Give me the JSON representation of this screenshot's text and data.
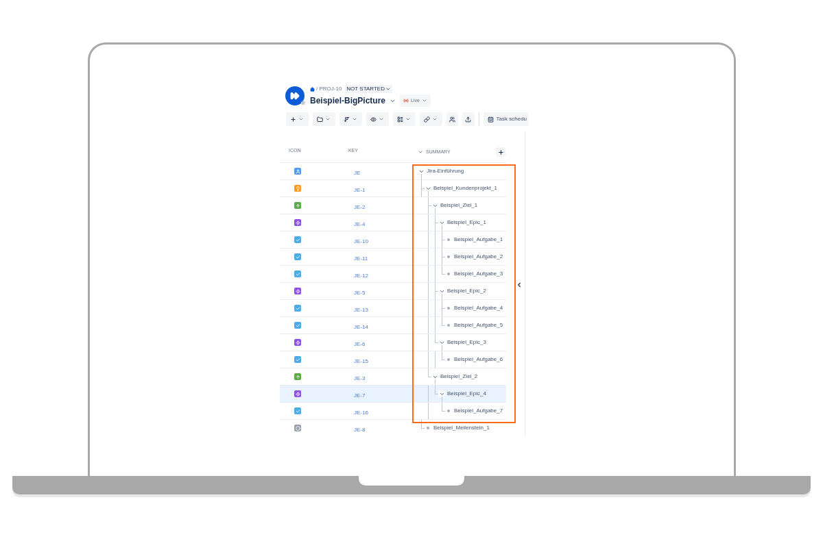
{
  "breadcrumb": {
    "project": "/ PROJ-10",
    "status": "NOT STARTED"
  },
  "title": "Beispiel-BigPicture",
  "mode_button": "Live",
  "toolbar": [
    {
      "kind": "plus"
    },
    {
      "kind": "folder"
    },
    {
      "kind": "sort"
    },
    {
      "kind": "eye"
    },
    {
      "kind": "layout"
    },
    {
      "kind": "link"
    },
    {
      "kind": "people"
    },
    {
      "kind": "upload"
    }
  ],
  "task_button": "Task schedu",
  "columns": [
    "ICON",
    "KEY",
    "SUMMARY"
  ],
  "rows": [
    {
      "kind": "project",
      "key": "JE",
      "summary": "Jira-Einführung",
      "expanded": true,
      "selected": false,
      "children": [
        {
          "kind": "idea",
          "key": "JE-1",
          "summary": "Beispiel_Kundenprojekt_1",
          "expanded": true,
          "selected": false,
          "children": [
            {
              "kind": "goal",
              "key": "JE-2",
              "summary": "Beispiel_Ziel_1",
              "expanded": true,
              "selected": false,
              "children": [
                {
                  "kind": "epic",
                  "key": "JE-4",
                  "summary": "Beispiel_Epic_1",
                  "expanded": true,
                  "selected": false,
                  "children": [
                    {
                      "kind": "task",
                      "key": "JE-10",
                      "summary": "Beispiel_Aufgabe_1",
                      "selected": false
                    },
                    {
                      "kind": "task",
                      "key": "JE-11",
                      "summary": "Beispiel_Aufgabe_2",
                      "selected": false
                    },
                    {
                      "kind": "task",
                      "key": "JE-12",
                      "summary": "Beispiel_Aufgabe_3",
                      "selected": false
                    }
                  ]
                },
                {
                  "kind": "epic",
                  "key": "JE-5",
                  "summary": "Beispiel_Epic_2",
                  "expanded": true,
                  "selected": false,
                  "children": [
                    {
                      "kind": "task",
                      "key": "JE-13",
                      "summary": "Beispiel_Aufgabe_4",
                      "selected": false
                    },
                    {
                      "kind": "task",
                      "key": "JE-14",
                      "summary": "Beispiel_Aufgabe_5",
                      "selected": false
                    }
                  ]
                },
                {
                  "kind": "epic",
                  "key": "JE-6",
                  "summary": "Beispiel_Epic_3",
                  "expanded": true,
                  "selected": false,
                  "children": [
                    {
                      "kind": "task",
                      "key": "JE-15",
                      "summary": "Beispiel_Aufgabe_6",
                      "selected": false
                    }
                  ]
                }
              ]
            },
            {
              "kind": "goal",
              "key": "JE-3",
              "summary": "Beispiel_Ziel_2",
              "expanded": true,
              "selected": false,
              "children": [
                {
                  "kind": "epic",
                  "key": "JE-7",
                  "summary": "Beispiel_Epic_4",
                  "expanded": true,
                  "selected": true,
                  "children": [
                    {
                      "kind": "task",
                      "key": "JE-16",
                      "summary": "Beispiel_Aufgabe_7",
                      "selected": false
                    }
                  ]
                }
              ]
            }
          ]
        },
        {
          "kind": "milestone",
          "key": "JE-8",
          "summary": "Beispiel_Meilenstein_1",
          "selected": false
        }
      ]
    }
  ]
}
